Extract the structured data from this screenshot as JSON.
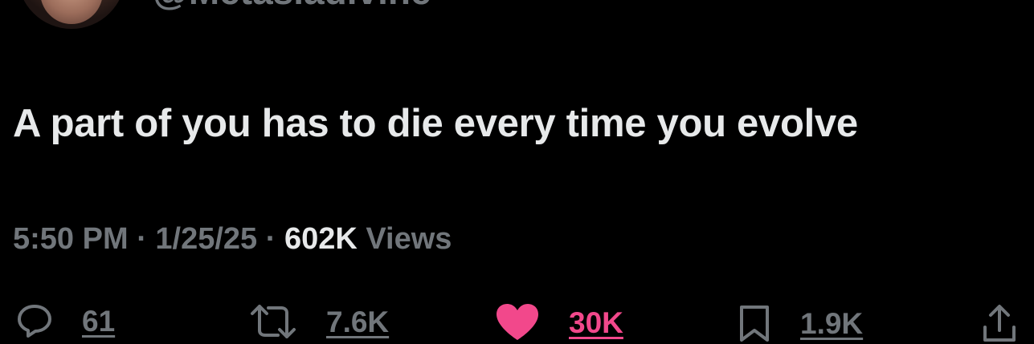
{
  "tweet": {
    "handle": "@Metasiadivine",
    "text": "A part of you has to die every time you evolve",
    "time": "5:50 PM",
    "date": "1/25/25",
    "separator": "·",
    "views_count": "602K",
    "views_label": "Views"
  },
  "actions": {
    "replies": "61",
    "reposts": "7.6K",
    "likes": "30K",
    "bookmarks": "1.9K"
  },
  "icons": {
    "reply": "reply-bubble-icon",
    "repost": "repost-icon",
    "like": "heart-icon",
    "bookmark": "bookmark-icon",
    "share": "share-icon"
  },
  "colors": {
    "background": "#000000",
    "text_primary": "#e7e9ea",
    "text_secondary": "#71767b",
    "like_active": "#f2488b"
  }
}
